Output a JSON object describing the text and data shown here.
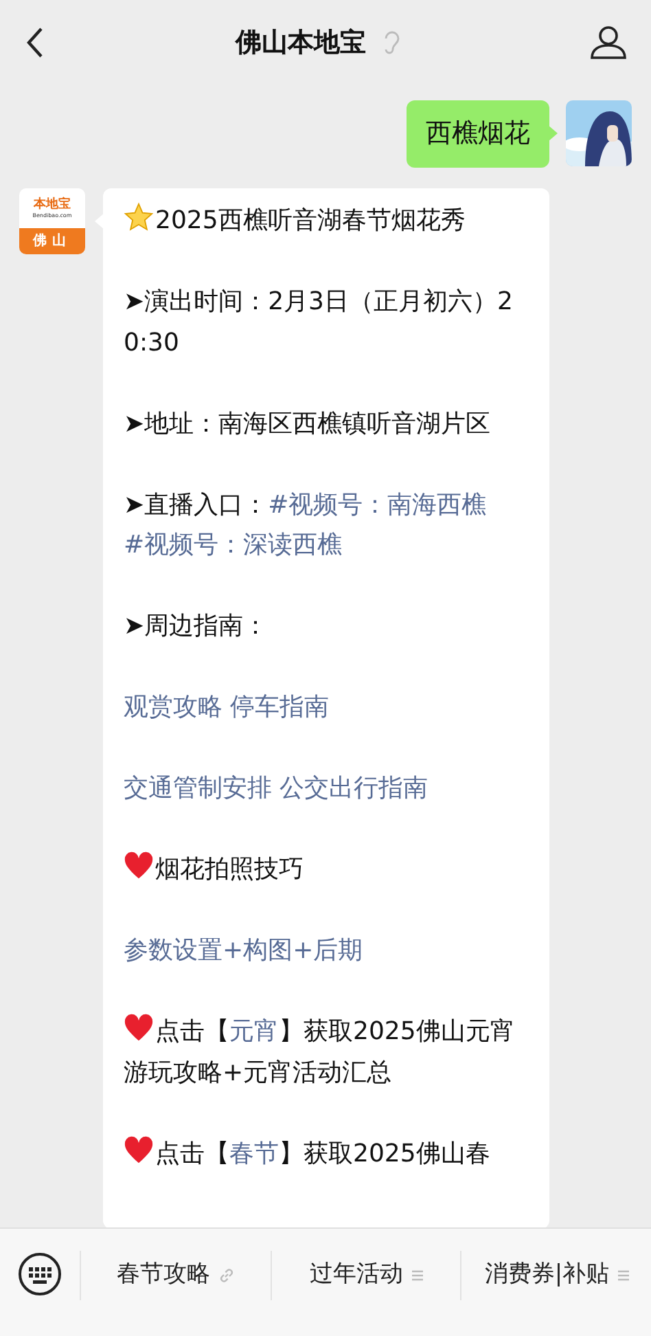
{
  "header": {
    "title": "佛山本地宝"
  },
  "messages": [
    {
      "kind": "user",
      "text": "西樵烟花"
    },
    {
      "kind": "bot",
      "logo": {
        "brand": "本地宝",
        "site": "Bendibao.com",
        "city": "佛山"
      },
      "paragraphs": [
        {
          "kind": "star",
          "segments": [
            {
              "kind": "text",
              "text": "2025西樵听音湖春节烟花秀"
            }
          ]
        },
        {
          "segments": [
            {
              "kind": "text",
              "text": "➤演出时间：2月3日（正月初六）20:30"
            }
          ]
        },
        {
          "segments": [
            {
              "kind": "text",
              "text": "➤地址：南海区西樵镇听音湖片区"
            }
          ]
        },
        {
          "segments": [
            {
              "kind": "text",
              "text": "➤直播入口："
            },
            {
              "kind": "link",
              "text": "#视频号：南海西樵"
            },
            {
              "kind": "link",
              "text": "#视频号：深读西樵"
            }
          ]
        },
        {
          "segments": [
            {
              "kind": "text",
              "text": "➤周边指南："
            }
          ]
        },
        {
          "segments": [
            {
              "kind": "link",
              "text": "观赏攻略"
            },
            {
              "kind": "link",
              "text": "停车指南"
            }
          ]
        },
        {
          "segments": [
            {
              "kind": "link",
              "text": "交通管制安排"
            },
            {
              "kind": "link",
              "text": "公交出行指南"
            }
          ]
        },
        {
          "kind": "heart",
          "segments": [
            {
              "kind": "text",
              "text": "烟花拍照技巧"
            }
          ]
        },
        {
          "segments": [
            {
              "kind": "link",
              "text": "参数设置+构图+后期"
            }
          ]
        },
        {
          "kind": "heart",
          "segments": [
            {
              "kind": "text",
              "text": "点击【"
            },
            {
              "kind": "link",
              "text": "元宵"
            },
            {
              "kind": "text",
              "text": "】获取2025佛山元宵游玩攻略+元宵活动汇总"
            }
          ]
        },
        {
          "kind": "heart",
          "segments": [
            {
              "kind": "text",
              "text": "点击【"
            },
            {
              "kind": "link",
              "text": "春节"
            },
            {
              "kind": "text",
              "text": "】获取2025佛山春"
            }
          ]
        }
      ]
    }
  ],
  "menu": [
    {
      "label": "春节攻略",
      "kind": "link"
    },
    {
      "label": "过年活动",
      "kind": "submenu"
    },
    {
      "label": "消费券|补贴",
      "kind": "submenu"
    }
  ]
}
